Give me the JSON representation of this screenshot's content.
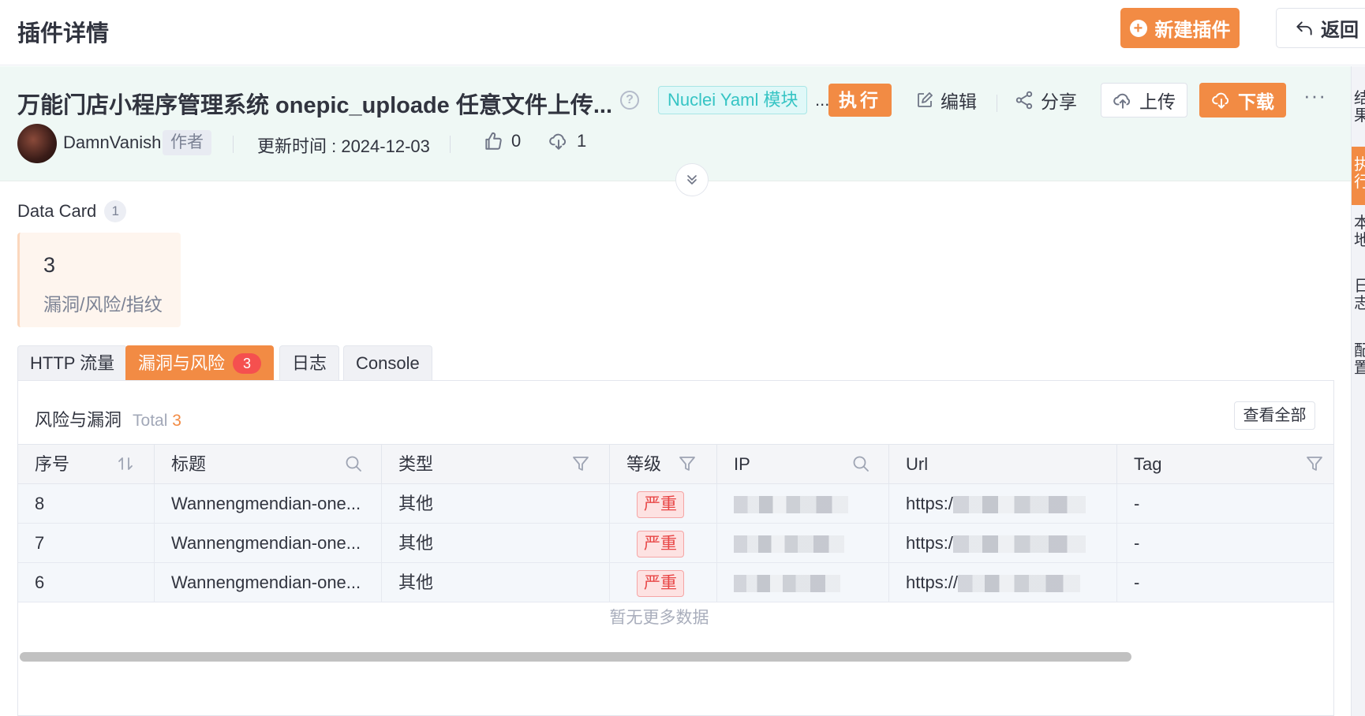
{
  "topbar": {
    "title": "插件详情",
    "new_plugin_label": "新建插件",
    "back_label": "返回"
  },
  "plugin": {
    "name": "万能门店小程序管理系统 onepic_uploade 任意文件上传...",
    "type_tag": "Nuclei Yaml 模块",
    "ellipsis": "...",
    "exec_label": "执行",
    "edit_label": "编辑",
    "share_label": "分享",
    "upload_label": "上传",
    "download_label": "下载",
    "more_label": "···"
  },
  "meta": {
    "author": "DamnVanish",
    "author_badge": "作者",
    "updated": "更新时间 : 2024-12-03",
    "likes": "0",
    "downloads": "1"
  },
  "right_tabs": [
    {
      "label": "结果",
      "active": false
    },
    {
      "label": "执行",
      "active": true
    },
    {
      "label": "本地",
      "active": false
    },
    {
      "label": "日志",
      "active": false
    },
    {
      "label": "配置",
      "active": false
    }
  ],
  "data_card": {
    "title": "Data Card",
    "count": "1",
    "value": "3",
    "label": "漏洞/风险/指纹"
  },
  "tabs": [
    {
      "label": "HTTP 流量"
    },
    {
      "label": "漏洞与风险",
      "count": "3"
    },
    {
      "label": "日志"
    },
    {
      "label": "Console"
    }
  ],
  "risk_table": {
    "title": "风险与漏洞",
    "total_label": "Total",
    "total_value": "3",
    "view_all": "查看全部",
    "columns": [
      "序号",
      "标题",
      "类型",
      "等级",
      "IP",
      "Url",
      "Tag"
    ],
    "rows": [
      {
        "id": "8",
        "title": "Wannengmendian-one...",
        "type": "其他",
        "level": "严重",
        "url": "https:/",
        "tag": "-"
      },
      {
        "id": "7",
        "title": "Wannengmendian-one...",
        "type": "其他",
        "level": "严重",
        "url": "https:/",
        "tag": "-"
      },
      {
        "id": "6",
        "title": "Wannengmendian-one...",
        "type": "其他",
        "level": "严重",
        "url": "https://",
        "tag": "-"
      }
    ],
    "empty_text": "暂无更多数据"
  },
  "colors": {
    "accent": "#f28b44",
    "header_bg": "#eff8f5",
    "tag_cyan": "#35c4c4",
    "severity_red": "#e84545"
  }
}
